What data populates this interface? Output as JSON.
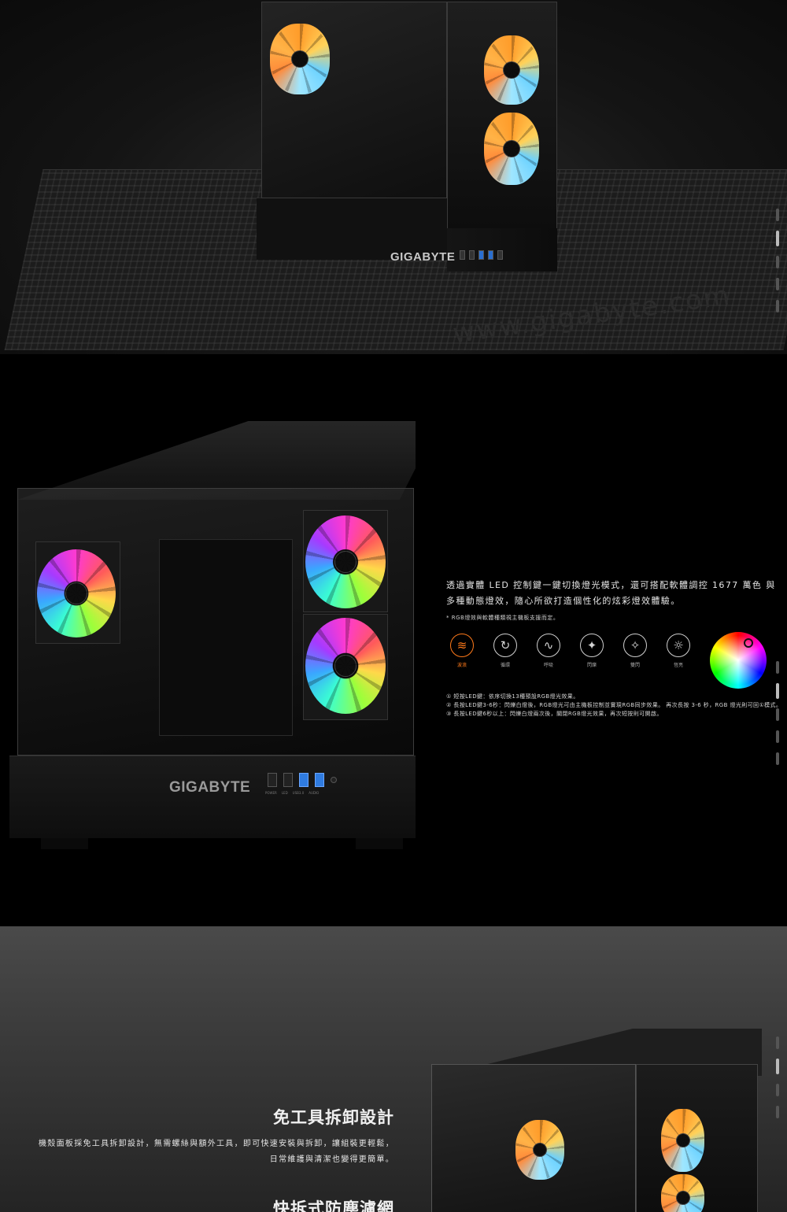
{
  "hero": {
    "brand_small": "GIGABYTE",
    "mat_watermark": "www.gigabyte.com"
  },
  "rgb_section": {
    "brand_big": "GIGABYTE",
    "port_labels": [
      "POWER",
      "LED",
      "USB3.0",
      "AUDIO"
    ],
    "description": "透過實體 LED 控制鍵一鍵切換燈光模式，還可搭配軟體調控 1677 萬色 與多種動態燈效，隨心所欲打造個性化的炫彩燈效體驗。",
    "note": "* RGB燈效與軟體種類視主機板支援而定。",
    "modes": [
      {
        "label": "波浪",
        "icon": "wave-icon",
        "glyph": "≋"
      },
      {
        "label": "循環",
        "icon": "cycle-icon",
        "glyph": "↻"
      },
      {
        "label": "呼吸",
        "icon": "breathe-icon",
        "glyph": "∿"
      },
      {
        "label": "閃爍",
        "icon": "flash-icon",
        "glyph": "✦"
      },
      {
        "label": "雙閃",
        "icon": "double-flash-icon",
        "glyph": "✧"
      },
      {
        "label": "恆亮",
        "icon": "static-icon",
        "glyph": "☼"
      }
    ],
    "steps": [
      "① 短按LED鍵：依序切換13種預設RGB燈光效果。",
      "② 長按LED鍵3-6秒：閃爍白燈後，RGB燈光可由主機板控制並實現RGB同步效果。 再次長按 3-6 秒，RGB 燈光則可回①模式。",
      "③ 長按LED鍵6秒以上：閃爍白燈兩次後，關閉RGB燈光效果，再次短按則可開啟。"
    ],
    "colors": {
      "accent": "#ff7a1a"
    }
  },
  "toolless_section": {
    "title": "免工具拆卸設計",
    "body": "機殼面板採免工具拆卸設計，無需螺絲與額外工具，即可快速安裝與拆卸，讓組裝更輕鬆，日常維護與清潔也變得更簡單。",
    "next_title": "快拆式防塵濾網"
  }
}
